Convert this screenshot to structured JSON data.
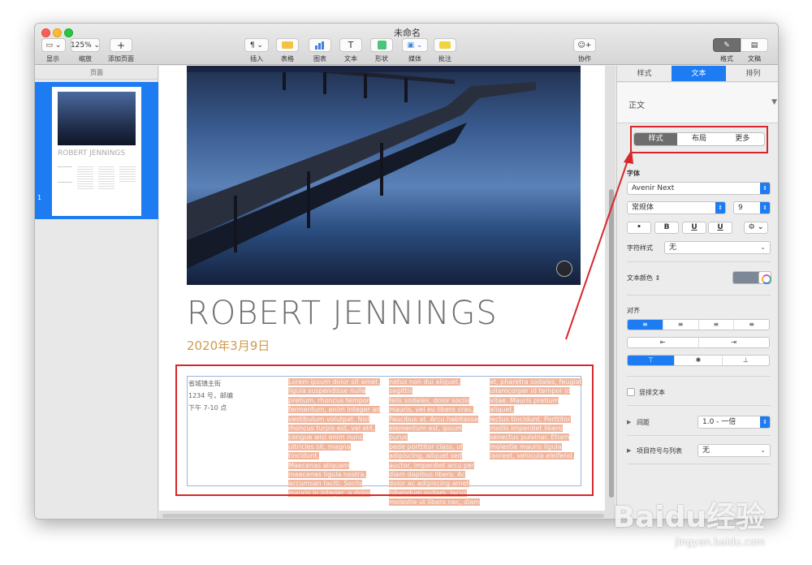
{
  "window": {
    "title": "未命名"
  },
  "toolbar": {
    "view_label": "显示",
    "zoom_value": "125%",
    "zoom_label": "缩放",
    "add_page_label": "添加页面",
    "insert_label": "插入",
    "table_label": "表格",
    "chart_label": "图表",
    "text_label": "文本",
    "shape_label": "形状",
    "media_label": "媒体",
    "comment_label": "批注",
    "collaborate_label": "协作",
    "format_label": "格式",
    "document_label": "文稿",
    "colors": {
      "table": "#f5c342",
      "chart": "#3c82e0",
      "shape": "#4cc47a",
      "comment": "#f2d33b"
    }
  },
  "pages_pane": {
    "title": "页面",
    "thumb_title": "ROBERT JENNINGS",
    "page_number": "1"
  },
  "document": {
    "title": "ROBERT JENNINGS",
    "date": "2020年3月9日",
    "address": [
      "省城镇主街",
      "1234 号，邮编",
      "下午 7-10 点"
    ],
    "columns": [
      [
        "Lorem ipsum dolor sit amet,",
        "ligula suspendisse nulla",
        "pretium, rhoncus tempor",
        "fermentum, enim integer ad",
        "vestibulum volutpat. Nisl",
        "rhoncus turpis est, vel elit,",
        "congue wisi enim nunc",
        "ultricies sit, magna tincidunt.",
        "Maecenas aliquam",
        "maecenas ligula nostra,",
        "accumsan taciti. Sociis",
        "mauris in integer, a dolor"
      ],
      [
        "netus non dui aliquet, sagittis",
        "felis sodales, dolor sociis",
        "mauris, vel eu libero cras.",
        "Faucibus at. Arcu habitasse",
        "elementum est, ipsum purus",
        "pede porttitor class, ut",
        "adipiscing, aliquet sed",
        "auctor, imperdiet arcu per",
        "diam dapibus libero. Ac",
        "dolor ac adipiscing amet",
        "bibendum nullam, lacus",
        "molestie ut libero nec, diam"
      ],
      [
        "et, pharetra sodales, feugiat",
        "ullamcorper id tempor id",
        "vitae. Mauris pretium aliquet,",
        "lectus tincidunt. Porttitor",
        "mollis imperdiet libero",
        "senectus pulvinar. Etiam",
        "molestie mauris ligula",
        "laoreet, vehicula eleifend."
      ]
    ]
  },
  "inspector": {
    "tabs": [
      "样式",
      "文本",
      "排列"
    ],
    "active_tab": "文本",
    "paragraph_style": "正文",
    "segments": [
      "样式",
      "布局",
      "更多"
    ],
    "font_heading": "字体",
    "font_name": "Avenir Next",
    "font_weight": "常规体",
    "font_size": "9",
    "format_buttons": [
      "•",
      "B",
      "U",
      "U"
    ],
    "char_style_label": "字符样式",
    "char_style_value": "无",
    "text_color_label": "文本颜色",
    "alignment_label": "对齐",
    "vertical_text_label": "竖排文本",
    "spacing_label": "间距",
    "spacing_value": "1.0 - 一倍",
    "bullets_label": "项目符号与列表",
    "bullets_value": "无",
    "text_color": "#7d8796",
    "accent": "#1d7cf2"
  },
  "watermark": {
    "brand": "Baidu经验",
    "url": "jingyan.baidu.com"
  }
}
